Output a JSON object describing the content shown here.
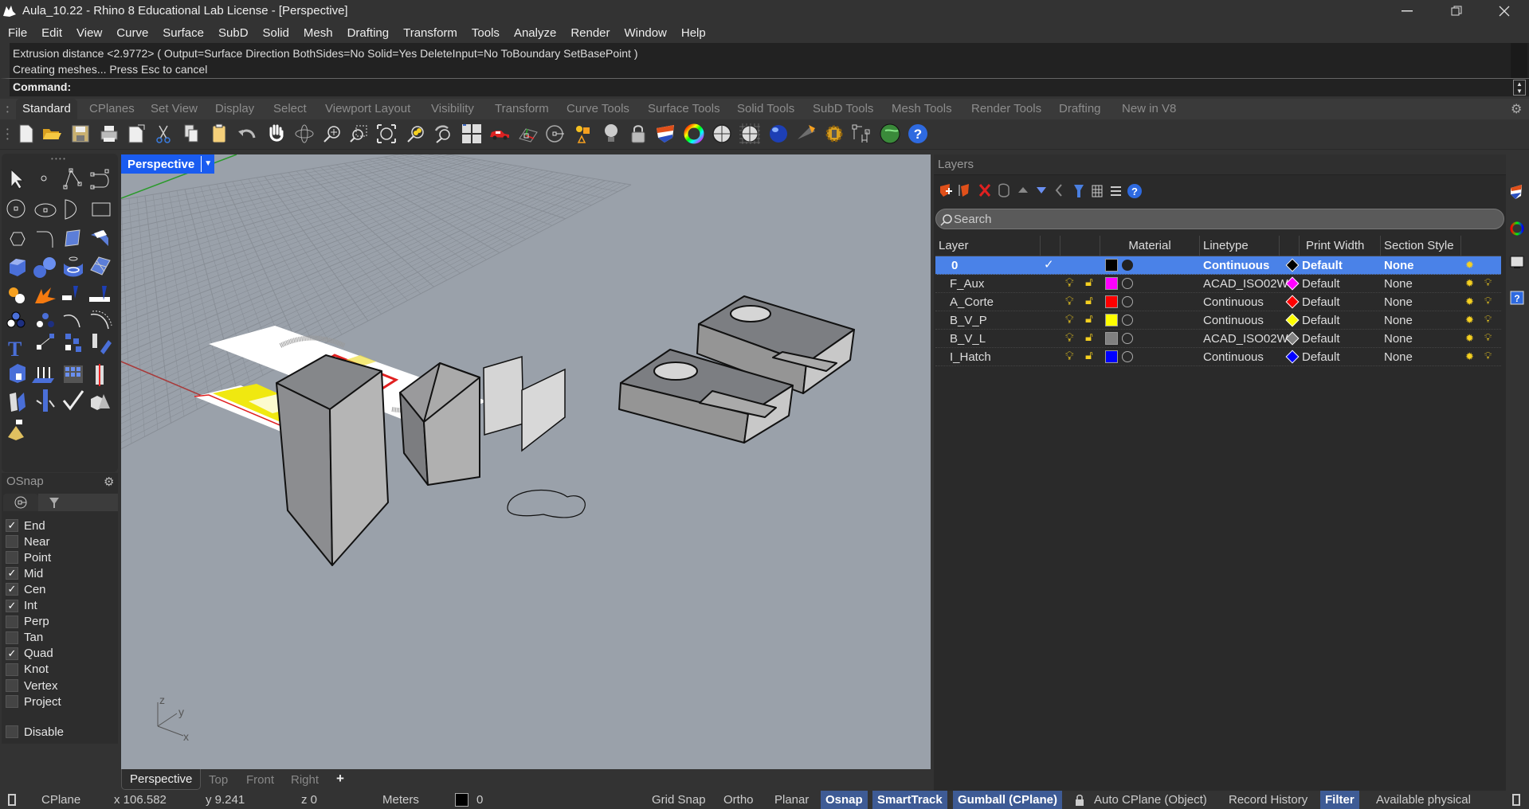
{
  "window": {
    "title": "Aula_10.22 - Rhino 8 Educational Lab License - [Perspective]",
    "controls": [
      "minimize",
      "restore",
      "close"
    ]
  },
  "menu": [
    "File",
    "Edit",
    "View",
    "Curve",
    "Surface",
    "SubD",
    "Solid",
    "Mesh",
    "Drafting",
    "Transform",
    "Tools",
    "Analyze",
    "Render",
    "Window",
    "Help"
  ],
  "command_history": {
    "line1": "Extrusion distance <2.9772> ( Output=Surface  Direction  BothSides=No  Solid=Yes  DeleteInput=No  ToBoundary  SetBasePoint )",
    "line2": "Creating meshes... Press Esc to cancel"
  },
  "command": {
    "label": "Command:",
    "value": ""
  },
  "toolbar_tabs": [
    "Standard",
    "CPlanes",
    "Set View",
    "Display",
    "Select",
    "Viewport Layout",
    "Visibility",
    "Transform",
    "Curve Tools",
    "Surface Tools",
    "Solid Tools",
    "SubD Tools",
    "Mesh Tools",
    "Render Tools",
    "Drafting",
    "New in V8"
  ],
  "active_toolbar_tab": "Standard",
  "standard_icons": [
    "new-icon",
    "open-icon",
    "save-icon",
    "print-icon",
    "import-icon",
    "cut-icon",
    "copy-icon",
    "paste-icon",
    "undo-icon",
    "pan-icon",
    "rotate-view-icon",
    "zoom-icon",
    "zoom-window-icon",
    "zoom-extents-icon",
    "zoom-selected-icon",
    "undo-view-icon",
    "viewport-layout-icon",
    "car-icon",
    "cplane-icon",
    "osnap-icon",
    "hide-icon",
    "light-icon",
    "lock-icon",
    "layer-icon",
    "color-wheel-icon",
    "shaded-sphere-icon",
    "wireframe-sphere-icon",
    "render-sphere-icon",
    "spotlight-icon",
    "options-gear-icon",
    "dimension-icon",
    "material-icon",
    "help-icon"
  ],
  "left_tools": [
    "select-icon",
    "point-icon",
    "polyline-icon",
    "curve-icon",
    "circle-icon",
    "ellipse-icon",
    "arc-icon",
    "rectangle-icon",
    "polygon-icon",
    "fillet-curve-icon",
    "surface-from-points-icon",
    "extrude-surface-icon",
    "box-icon",
    "sphere-icon",
    "cylinder-icon",
    "mesh-surface-icon",
    "boolean-icon",
    "explode-icon",
    "trim-icon",
    "split-icon",
    "group-icon",
    "ungroup-icon",
    "offset-icon",
    "offset-curve-icon",
    "text-icon",
    "scale-icon",
    "array-icon",
    "rotate-icon",
    "block-icon",
    "extrude-icon",
    "grid-array-icon",
    "mirror-icon",
    "join-icon",
    "dimension-tool-icon",
    "check-icon",
    "solid-shapes-icon",
    "pyramid-icon"
  ],
  "osnap": {
    "title": "OSnap",
    "items": [
      {
        "label": "End",
        "checked": true
      },
      {
        "label": "Near",
        "checked": false
      },
      {
        "label": "Point",
        "checked": false
      },
      {
        "label": "Mid",
        "checked": true
      },
      {
        "label": "Cen",
        "checked": true
      },
      {
        "label": "Int",
        "checked": true
      },
      {
        "label": "Perp",
        "checked": false
      },
      {
        "label": "Tan",
        "checked": false
      },
      {
        "label": "Quad",
        "checked": true
      },
      {
        "label": "Knot",
        "checked": false
      },
      {
        "label": "Vertex",
        "checked": false
      },
      {
        "label": "Project",
        "checked": false
      }
    ],
    "disable": {
      "label": "Disable",
      "checked": false
    }
  },
  "viewport": {
    "name": "Perspective",
    "axis_labels": {
      "z": "z",
      "y": "y",
      "x": "x"
    },
    "tabs": [
      "Perspective",
      "Top",
      "Front",
      "Right"
    ],
    "add_tab": "+"
  },
  "layers": {
    "title": "Layers",
    "search_placeholder": "Search",
    "columns": [
      "Layer",
      "",
      "",
      "Material",
      "Linetype",
      "",
      "Print Width",
      "Section Style"
    ],
    "rows": [
      {
        "name": "0",
        "current": true,
        "color": "#000000",
        "linetype": "Continuous",
        "print_color": "#000000",
        "print_width": "Default",
        "section_style": "None",
        "selected": true
      },
      {
        "name": "F_Aux",
        "current": false,
        "color": "#ff00ff",
        "linetype": "ACAD_ISO02W",
        "print_color": "#ff00ff",
        "print_width": "Default",
        "section_style": "None",
        "selected": false
      },
      {
        "name": "A_Corte",
        "current": false,
        "color": "#ff0000",
        "linetype": "Continuous",
        "print_color": "#ff0000",
        "print_width": "Default",
        "section_style": "None",
        "selected": false
      },
      {
        "name": "B_V_P",
        "current": false,
        "color": "#ffff00",
        "linetype": "Continuous",
        "print_color": "#ffff00",
        "print_width": "Default",
        "section_style": "None",
        "selected": false
      },
      {
        "name": "B_V_L",
        "current": false,
        "color": "#808080",
        "linetype": "ACAD_ISO02W",
        "print_color": "#808080",
        "print_width": "Default",
        "section_style": "None",
        "selected": false
      },
      {
        "name": "I_Hatch",
        "current": false,
        "color": "#0000ff",
        "linetype": "Continuous",
        "print_color": "#0000ff",
        "print_width": "Default",
        "section_style": "None",
        "selected": false
      }
    ]
  },
  "statusbar": {
    "cplane": "CPlane",
    "x": "x 106.582",
    "y": "y 9.241",
    "z": "z 0",
    "units": "Meters",
    "layer": "0",
    "toggles": [
      {
        "label": "Grid Snap",
        "on": false
      },
      {
        "label": "Ortho",
        "on": false
      },
      {
        "label": "Planar",
        "on": false
      },
      {
        "label": "Osnap",
        "on": true
      },
      {
        "label": "SmartTrack",
        "on": true
      },
      {
        "label": "Gumball (CPlane)",
        "on": true
      },
      {
        "label": "Auto CPlane (Object)",
        "on": false
      },
      {
        "label": "Record History",
        "on": false
      },
      {
        "label": "Filter",
        "on": true
      },
      {
        "label": "Available physical",
        "on": false
      }
    ]
  },
  "colors": {
    "accent": "#4a82e8",
    "viewport_bg": "#9aa1aa",
    "status_on": "#3e5b95"
  }
}
